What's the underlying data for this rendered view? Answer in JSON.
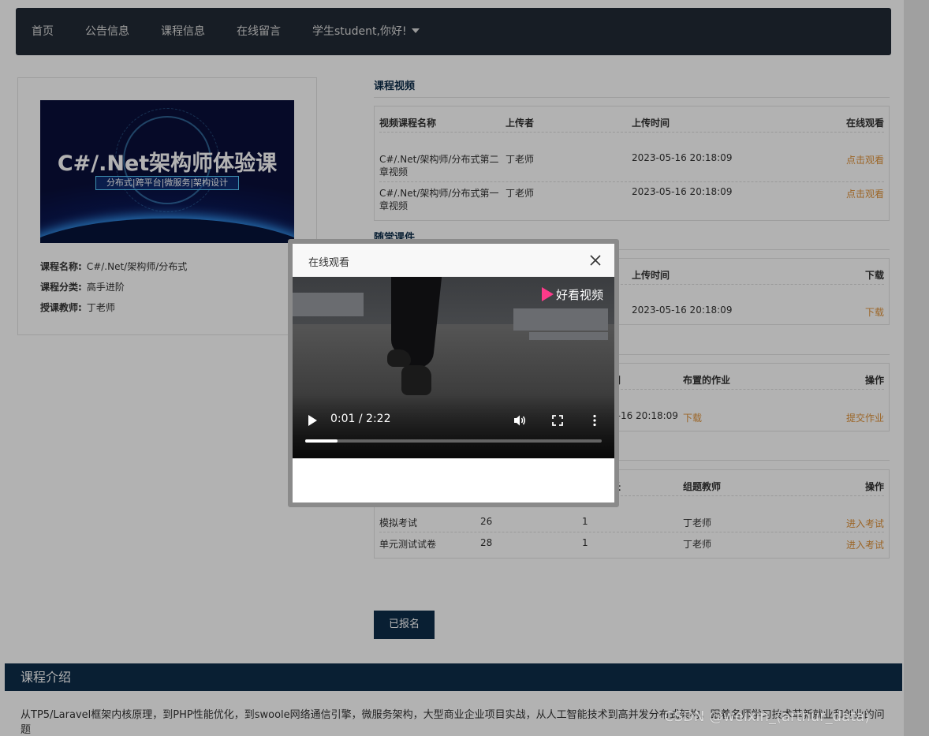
{
  "nav": {
    "items": [
      "首页",
      "公告信息",
      "课程信息",
      "在线留言"
    ],
    "user": "学生student,你好!"
  },
  "course": {
    "banner_title": "C#/.Net架构师体验课",
    "banner_sub": "分布式|跨平台|微服务|架构设计",
    "name_label": "课程名称:",
    "name": "C#/.Net/架构师/分布式",
    "category_label": "课程分类:",
    "category": "高手进阶",
    "teacher_label": "授课教师:",
    "teacher": "丁老师"
  },
  "videos": {
    "title": "课程视频",
    "headers": [
      "视频课程名称",
      "上传者",
      "上传时间",
      "在线观看"
    ],
    "rows": [
      {
        "name": "C#/.Net/架构师/分布式第二章视频",
        "uploader": "丁老师",
        "time": "2023-05-16 20:18:09",
        "action": "点击观看"
      },
      {
        "name": "C#/.Net/架构师/分布式第一章视频",
        "uploader": "丁老师",
        "time": "2023-05-16 20:18:09",
        "action": "点击观看"
      }
    ]
  },
  "courseware": {
    "title": "随堂课件",
    "headers": [
      "上传时间",
      "下载"
    ],
    "rows": [
      {
        "time": "2023-05-16 20:18:09",
        "action": "下载"
      }
    ]
  },
  "homework": {
    "headers": [
      "间",
      "布置的作业",
      "操作"
    ],
    "rows": [
      {
        "time": "5-16 20:18:09",
        "file": "下载",
        "action": "提交作业"
      }
    ]
  },
  "exams": {
    "headers": [
      "长",
      "组题教师",
      "操作"
    ],
    "rows": [
      {
        "name": "模拟考试",
        "col2": "26",
        "col3": "1",
        "teacher": "丁老师",
        "action": "进入考试"
      },
      {
        "name": "单元测试试卷",
        "col2": "28",
        "col3": "1",
        "teacher": "丁老师",
        "action": "进入考试"
      }
    ]
  },
  "enroll_button": "已报名",
  "intro": {
    "title": "课程介绍",
    "text": "从TP5/Laravel框架内核原理，到PHP性能优化，到swoole网络通信引擎，微服务架构，大型商业企业项目实战，从人工智能技术到高并发分布式架构，跟着名师学习技术革新就业和创业的问题"
  },
  "modal": {
    "title": "在线观看",
    "video_time": "0:01 / 2:22",
    "video_logo": "好看视频",
    "progress": 0.11
  },
  "watermark": "CSDN @weixin_(arthur_data)"
}
